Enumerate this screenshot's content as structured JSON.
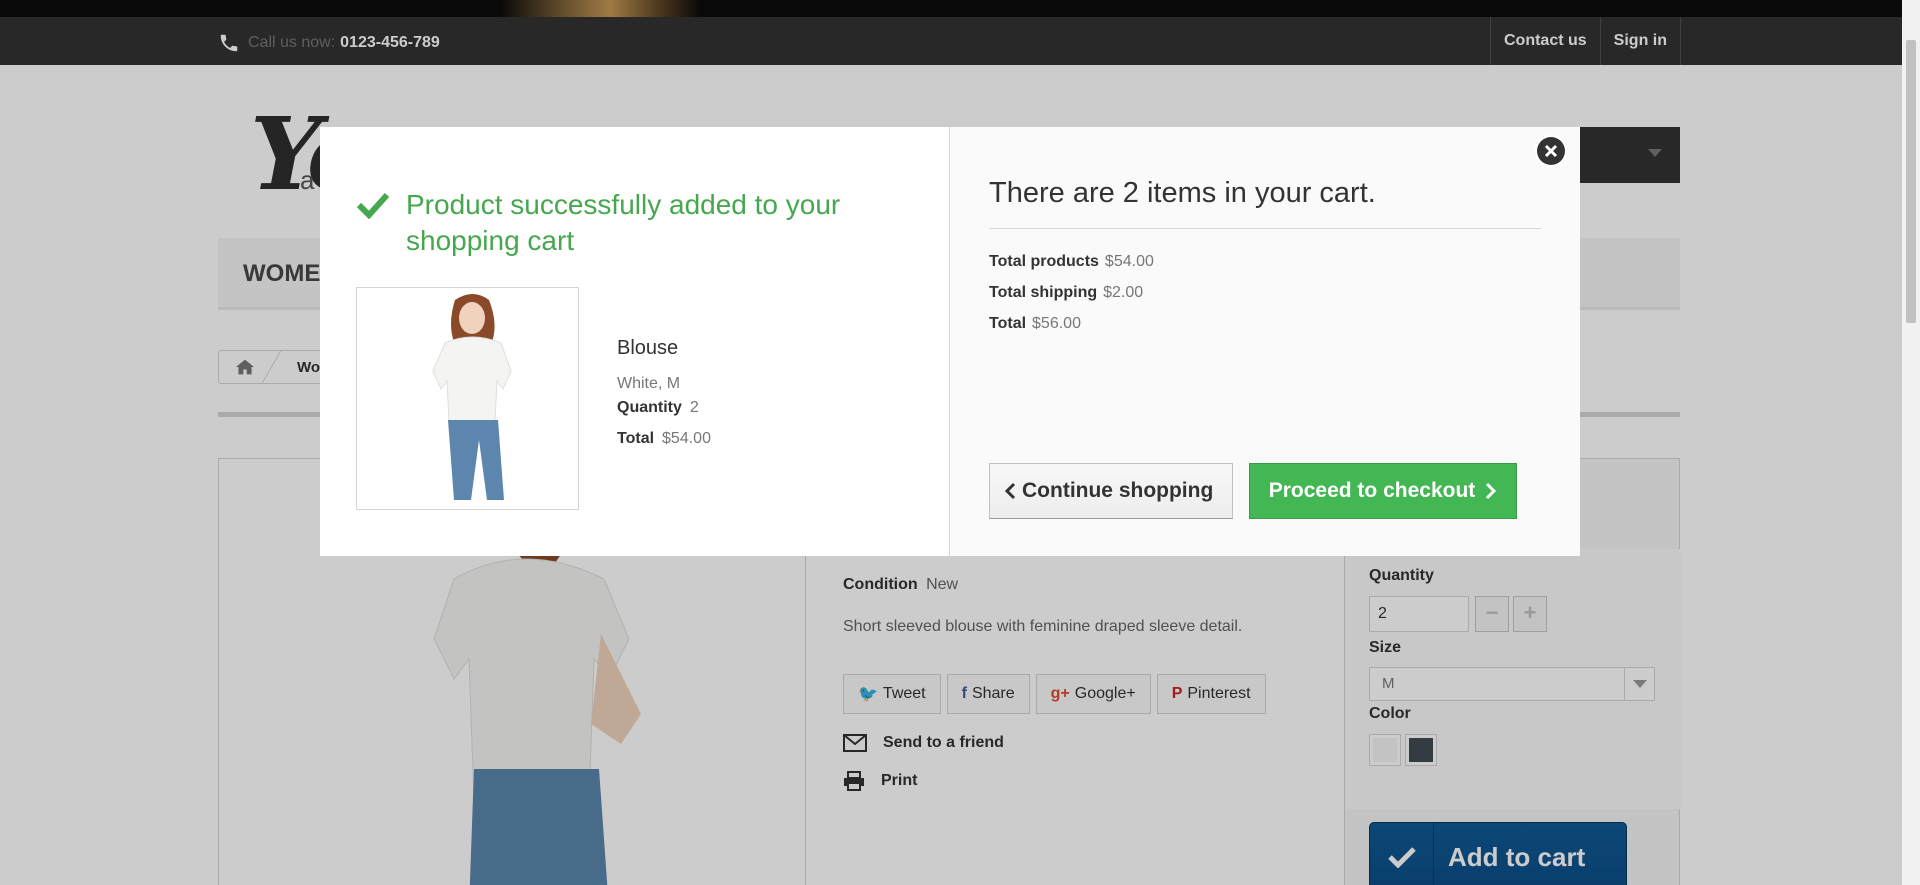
{
  "topbar": {
    "call_label": "Call us now:",
    "phone": "0123-456-789",
    "links": [
      {
        "label": "Contact us"
      },
      {
        "label": "Sign in"
      }
    ]
  },
  "menu": {
    "first_item": "WOMEN"
  },
  "breadcrumb": {
    "crumb": "Wo"
  },
  "product_page": {
    "condition_label": "Condition",
    "condition_value": "New",
    "short_description": "Short sleeved blouse with feminine draped sleeve detail.",
    "social": [
      {
        "icon": "twitter-icon",
        "glyph": "🐦",
        "label": "Tweet",
        "color": "#2bb9e6"
      },
      {
        "icon": "facebook-icon",
        "glyph": "f",
        "label": "Share",
        "color": "#435f9f"
      },
      {
        "icon": "google-plus-icon",
        "glyph": "g+",
        "label": "Google+",
        "color": "#e04b34"
      },
      {
        "icon": "pinterest-icon",
        "glyph": "P",
        "label": "Pinterest",
        "color": "#ce1f21"
      }
    ],
    "send_to_friend": "Send to a friend",
    "print": "Print",
    "quantity_label": "Quantity",
    "quantity_value": "2",
    "size_label": "Size",
    "size_value": "M",
    "color_label": "Color",
    "colors": [
      "#f4f4f4",
      "#434a54"
    ],
    "add_to_cart": "Add to cart"
  },
  "modal": {
    "success_title": "Product successfully added to your shopping cart",
    "product": {
      "name": "Blouse",
      "attributes": "White, M",
      "quantity_label": "Quantity",
      "quantity": "2",
      "total_label": "Total",
      "total": "$54.00"
    },
    "cart_title": "There are 2 items in your cart.",
    "totals": [
      {
        "label": "Total products",
        "value": "$54.00"
      },
      {
        "label": "Total shipping",
        "value": "$2.00"
      },
      {
        "label": "Total",
        "value": "$56.00"
      }
    ],
    "continue_label": "Continue shopping",
    "checkout_label": "Proceed to checkout"
  },
  "colors": {
    "success_green": "#46a74e",
    "checkout_green": "#43b754",
    "topbar_dark": "#333333",
    "add_to_cart_blue": "#0f5a96"
  }
}
